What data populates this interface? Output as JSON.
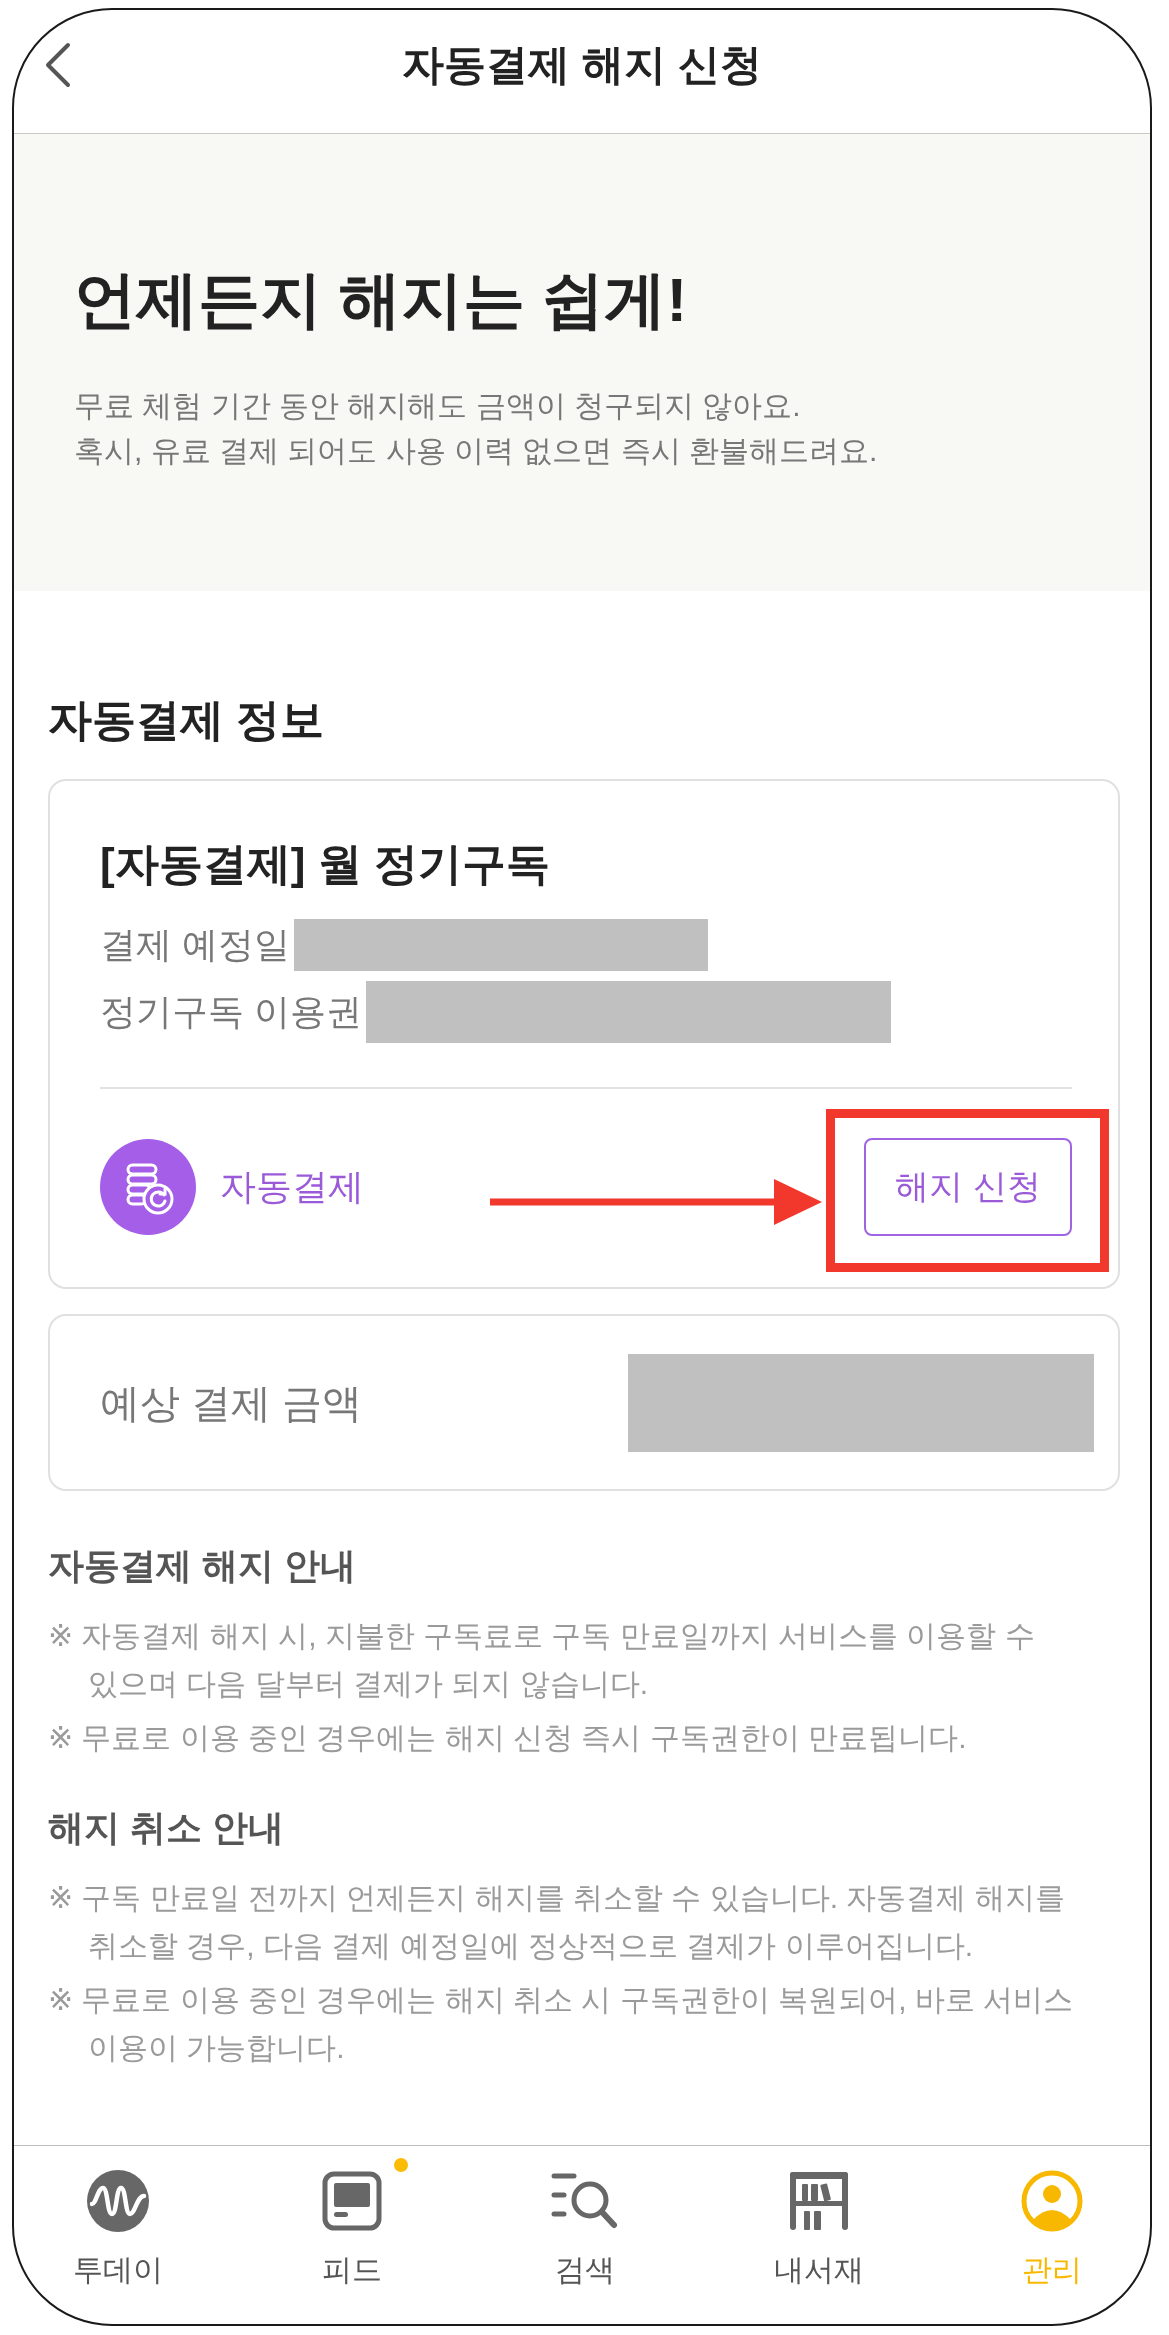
{
  "header": {
    "title": "자동결제 해지 신청"
  },
  "hero": {
    "title": "언제든지 해지는 쉽게!",
    "lines": [
      "무료 체험 기간 동안 해지해도 금액이 청구되지 않아요.",
      "혹시, 유료 결제 되어도 사용 이력 없으면 즉시 환불해드려요."
    ]
  },
  "payment_info": {
    "heading": "자동결제 정보",
    "plan": {
      "title": "[자동결제] 월 정기구독",
      "fields": [
        {
          "label": "결제 예정일",
          "redacted": true
        },
        {
          "label": "정기구독 이용권",
          "redacted": true
        }
      ],
      "method": "자동결제",
      "cancel_button": {
        "label": "해지 신청",
        "highlighted": true
      }
    },
    "estimate": {
      "label": "예상 결제 금액",
      "redacted": true
    }
  },
  "notices": [
    {
      "heading": "자동결제 해지 안내",
      "items": [
        "※ 자동결제 해지 시, 지불한 구독료로 구독 만료일까지 서비스를 이용할 수 있으며 다음 달부터 결제가 되지 않습니다.",
        "※ 무료로 이용 중인 경우에는 해지 신청 즉시 구독권한이 만료됩니다."
      ]
    },
    {
      "heading": "해지 취소 안내",
      "items": [
        "※ 구독 만료일 전까지 언제든지 해지를 취소할 수 있습니다. 자동결제 해지를 취소할 경우, 다음 결제 예정일에 정상적으로 결제가 이루어집니다.",
        "※ 무료로 이용 중인 경우에는 해지 취소 시 구독권한이 복원되어, 바로 서비스 이용이 가능합니다."
      ]
    }
  ],
  "nav": [
    {
      "label": "투데이",
      "kind": "today",
      "selected": false,
      "badge": false
    },
    {
      "label": "피드",
      "kind": "feed",
      "selected": false,
      "badge": true
    },
    {
      "label": "검색",
      "kind": "search",
      "selected": false,
      "badge": false
    },
    {
      "label": "내서재",
      "kind": "library",
      "selected": false,
      "badge": false
    },
    {
      "label": "관리",
      "kind": "profile",
      "selected": true,
      "badge": false
    }
  ]
}
